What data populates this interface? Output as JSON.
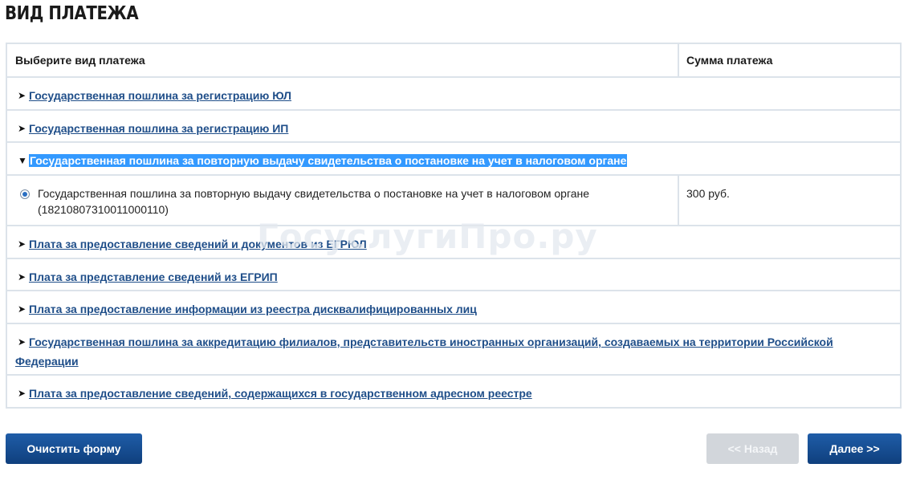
{
  "page": {
    "title": "ВИД ПЛАТЕЖА",
    "watermark": "ГосуслугиПро.ру"
  },
  "table": {
    "header": {
      "type_label": "Выберите вид платежа",
      "sum_label": "Сумма платежа"
    },
    "categories": [
      {
        "label": "Государственная пошлина за регистрацию ЮЛ",
        "expanded": false
      },
      {
        "label": "Государственная пошлина за регистрацию ИП",
        "expanded": false
      },
      {
        "label": "Государственная пошлина за повторную выдачу свидетельства о постановке на учет в налоговом органе",
        "expanded": true,
        "selected": true
      },
      {
        "label": "Плата за предоставление сведений и документов из ЕГРЮЛ",
        "expanded": false
      },
      {
        "label": "Плата за представление сведений из ЕГРИП",
        "expanded": false
      },
      {
        "label": "Плата за предоставление информации из реестра дисквалифицированных лиц",
        "expanded": false
      },
      {
        "label": "Государственная пошлина за аккредитацию филиалов, представительств иностранных организаций, создаваемых на территории Российской Федерации",
        "expanded": false
      },
      {
        "label": "Плата за предоставление сведений, содержащихся в государственном адресном реестре",
        "expanded": false
      }
    ],
    "selected_option": {
      "text": "Государственная пошлина за повторную выдачу свидетельства о постановке на учет в налоговом органе (18210807310011000110)",
      "sum": "300 руб.",
      "checked": true
    }
  },
  "buttons": {
    "clear": "Очистить форму",
    "back": "<< Назад",
    "next": "Далее >>"
  },
  "colors": {
    "link": "#1f4e89",
    "selection": "#3399ff",
    "primary_button": "#174d94",
    "disabled_button": "#d2d6db",
    "border": "#dce3ea"
  },
  "icons": {
    "collapsed": "triangle-right-icon",
    "expanded": "triangle-down-icon",
    "radio": "radio-checked-icon"
  }
}
